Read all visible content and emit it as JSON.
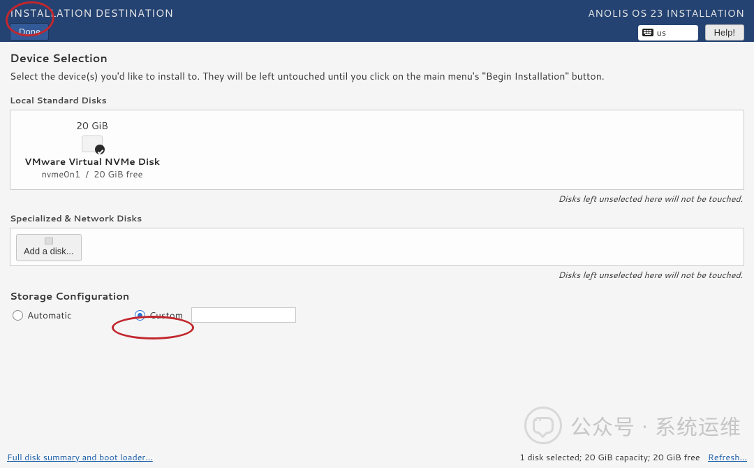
{
  "header": {
    "page_title": "INSTALLATION DESTINATION",
    "done_label": "Done",
    "product_title": "ANOLIS OS 23 INSTALLATION",
    "keyboard_layout": "us",
    "help_label": "Help!"
  },
  "device_selection": {
    "heading": "Device Selection",
    "description": "Select the device(s) you'd like to install to.  They will be left untouched until you click on the main menu's \"Begin Installation\" button."
  },
  "local_disks": {
    "group_label": "Local Standard Disks",
    "note": "Disks left unselected here will not be touched.",
    "disks": [
      {
        "size": "20 GiB",
        "name": "VMware Virtual NVMe Disk",
        "device": "nvme0n1",
        "free": "20 GiB free",
        "selected": true
      }
    ]
  },
  "network_disks": {
    "group_label": "Specialized & Network Disks",
    "add_label": "Add a disk...",
    "note": "Disks left unselected here will not be touched."
  },
  "storage_config": {
    "heading": "Storage Configuration",
    "options": {
      "automatic": "Automatic",
      "custom": "Custom"
    },
    "selected": "custom"
  },
  "footer": {
    "summary_link": "Full disk summary and boot loader...",
    "status": "1 disk selected; 20 GiB capacity; 20 GiB free",
    "refresh_label": "Refresh..."
  },
  "watermark": {
    "text": "公众号 · 系统运维"
  }
}
